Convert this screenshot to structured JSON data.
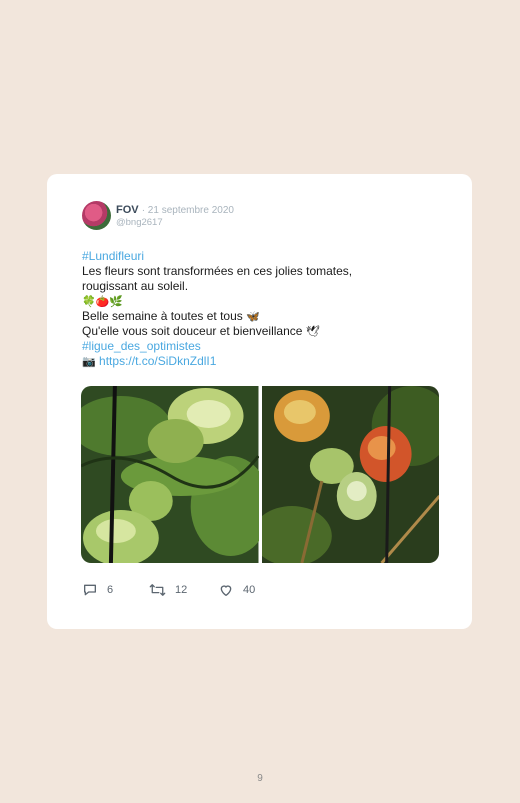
{
  "tweet": {
    "name": "FOV",
    "date": "· 21 septembre 2020",
    "handle": "@bng2617",
    "hashtag1": "#Lundifleuri",
    "line1": "Les fleurs sont transformées en ces jolies tomates,",
    "line2": "rougissant au soleil.",
    "emoji_line": "🍀🍅🌿",
    "line3": "Belle semaine à toutes et tous",
    "line3_emoji": "🦋",
    "line4": "Qu'elle vous soit douceur et bienveillance",
    "line4_emoji": "🕊",
    "hashtag2": "#ligue_des_optimistes",
    "camera_emoji": "📷",
    "url": "https://t.co/SiDknZdlI1"
  },
  "stats": {
    "replies": "6",
    "retweets": "12",
    "likes": "40"
  },
  "icons": {
    "reply": "reply-icon",
    "retweet": "retweet-icon",
    "like": "heart-icon"
  },
  "page_number": "9"
}
